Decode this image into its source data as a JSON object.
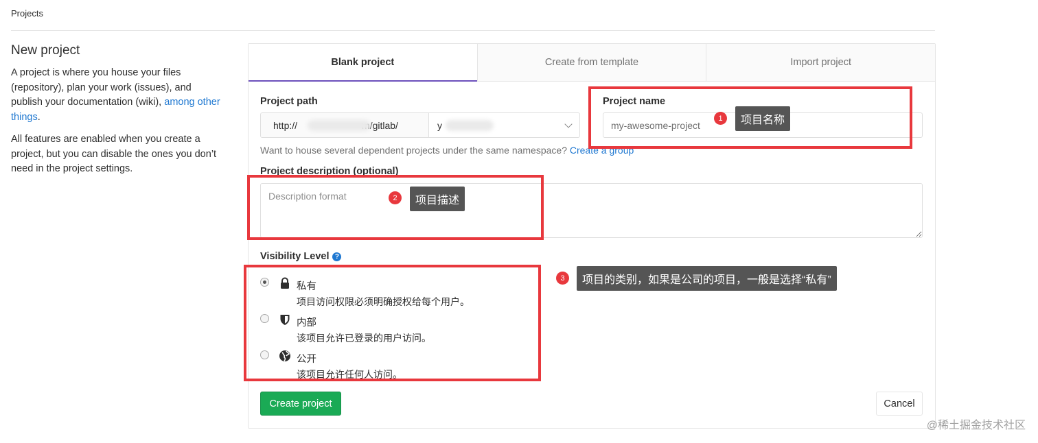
{
  "breadcrumb": {
    "label": "Projects"
  },
  "intro": {
    "title": "New project",
    "paragraph1": "A project is where you house your files (repository), plan your work (issues), and publish your documentation (wiki), ",
    "paragraph1_link": "among other things",
    "paragraph1_end": ".",
    "paragraph2": "All features are enabled when you create a project, but you can disable the ones you don’t need in the project settings."
  },
  "tabs": [
    {
      "label": "Blank project",
      "active": true
    },
    {
      "label": "Create from template",
      "active": false
    },
    {
      "label": "Import project",
      "active": false
    }
  ],
  "form": {
    "path_label": "Project path",
    "path_prefix_start": "http://",
    "path_prefix_end": "m/gitlab/",
    "namespace_value": "y",
    "name_label": "Project name",
    "name_placeholder": "my-awesome-project",
    "hint_text": "Want to house several dependent projects under the same namespace? ",
    "hint_link": "Create a group",
    "description_label": "Project description (optional)",
    "description_placeholder": "Description format",
    "visibility_label": "Visibility Level",
    "visibility_options": [
      {
        "title": "私有",
        "description": "项目访问权限必须明确授权给每个用户。",
        "icon": "lock-icon",
        "checked": true
      },
      {
        "title": "内部",
        "description": "该项目允许已登录的用户访问。",
        "icon": "shield-icon",
        "checked": false
      },
      {
        "title": "公开",
        "description": "该项目允许任何人访问。",
        "icon": "globe-icon",
        "checked": false
      }
    ],
    "create_button": "Create project",
    "cancel_button": "Cancel"
  },
  "annotations": [
    {
      "number": "1",
      "text": "项目名称"
    },
    {
      "number": "2",
      "text": "项目描述"
    },
    {
      "number": "3",
      "text": "项目的类别，如果是公司的项目，一般是选择“私有”"
    }
  ],
  "watermark": "@稀土掘金技术社区",
  "colors": {
    "accent_link": "#1f78d1",
    "tab_active_underline": "#6b4fbb",
    "create_button": "#1aaa55",
    "annotation_red": "#e8383d",
    "callout_bg": "#555555"
  }
}
